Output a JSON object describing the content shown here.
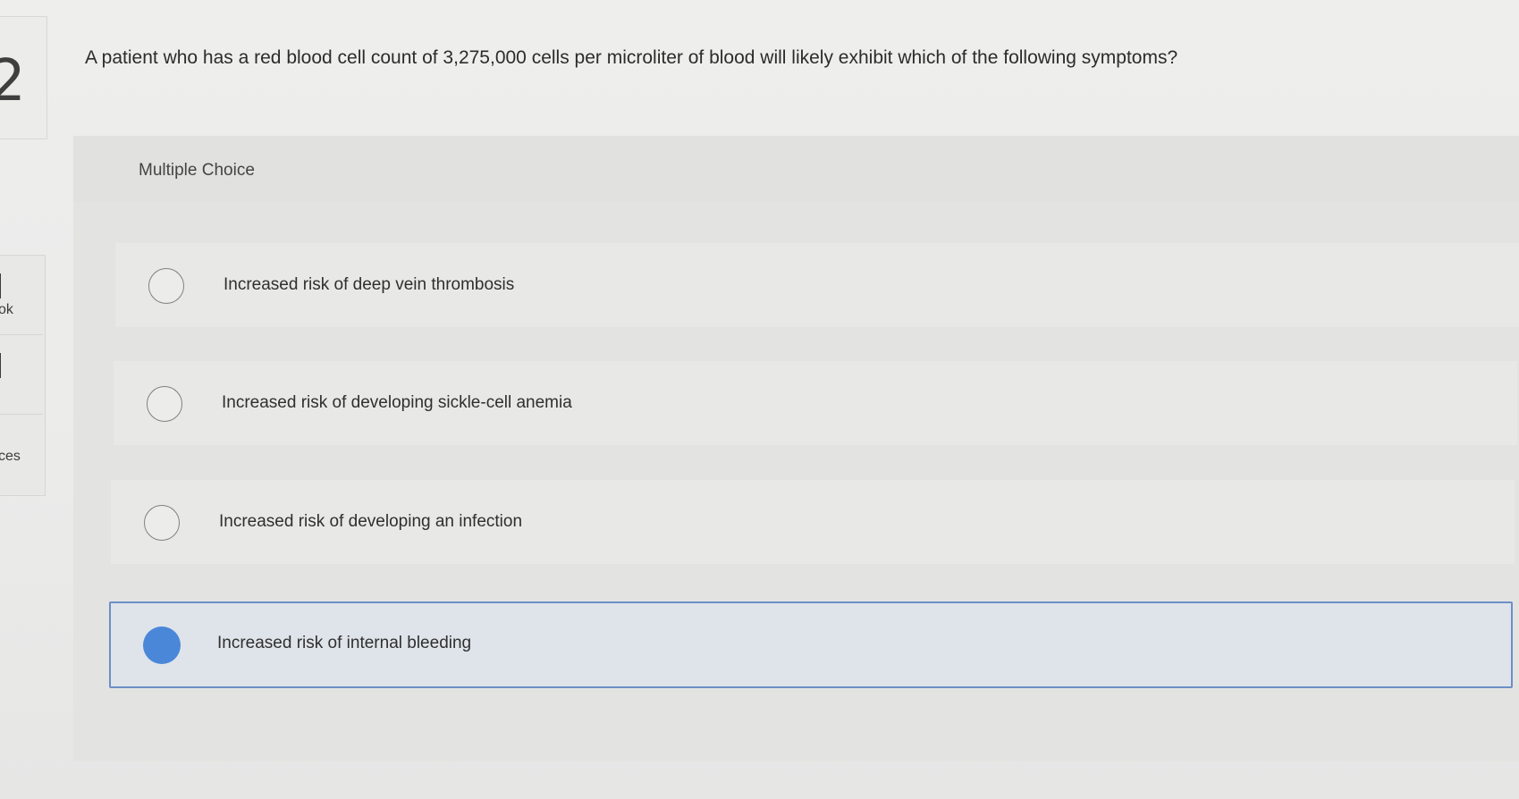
{
  "sidebar": {
    "question_number": "2",
    "items": [
      {
        "label": "ok"
      },
      {
        "label": ""
      },
      {
        "label": "ces"
      }
    ]
  },
  "question": {
    "text": "A patient who has a red blood cell count of  3,275,000 cells per microliter of blood will likely exhibit which of the following symptoms?"
  },
  "choices": {
    "header": "Multiple Choice",
    "options": [
      {
        "label": "Increased risk of deep vein thrombosis",
        "selected": false
      },
      {
        "label": "Increased risk of developing sickle-cell anemia",
        "selected": false
      },
      {
        "label": "Increased risk of developing an infection",
        "selected": false
      },
      {
        "label": "Increased risk of internal bleeding",
        "selected": true
      }
    ]
  },
  "colors": {
    "selected_radio": "#4a87d8",
    "selected_border": "#6d8fc6",
    "selected_background": "#dfe4ea"
  }
}
